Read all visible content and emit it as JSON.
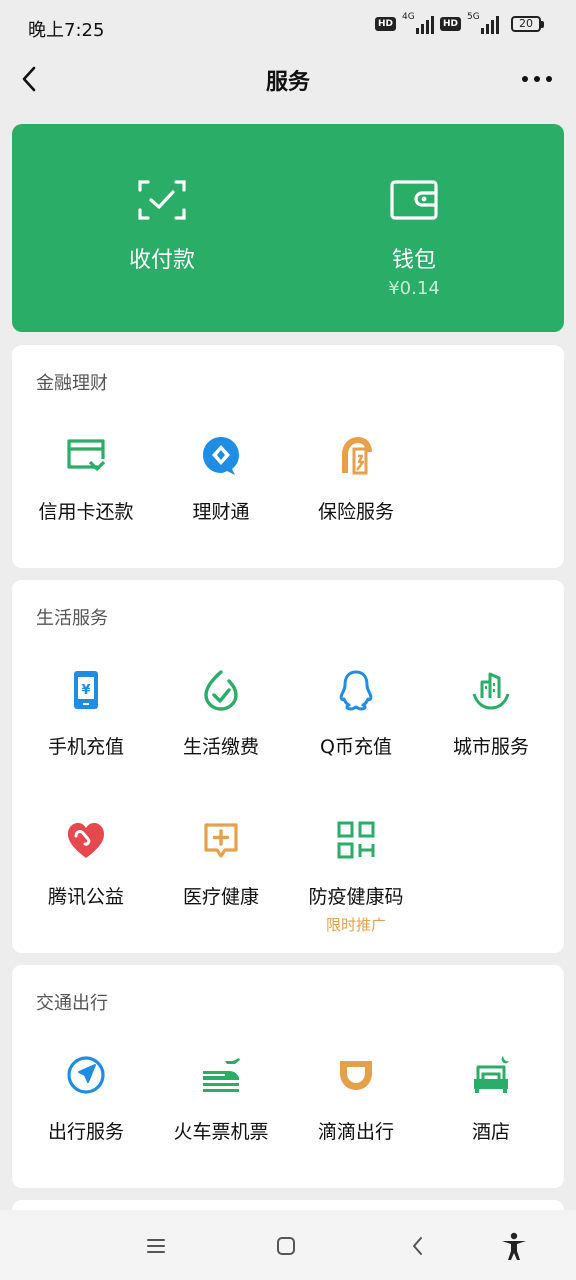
{
  "status_bar": {
    "time": "晚上7:25",
    "network_1": "4G",
    "network_2": "5G",
    "hd": "HD",
    "battery": "20"
  },
  "nav": {
    "title": "服务"
  },
  "wallet_card": {
    "color": "#2aae67",
    "pay": {
      "label": "收付款",
      "icon": "scan-check-icon"
    },
    "wallet": {
      "label": "钱包",
      "balance": "¥0.14",
      "icon": "wallet-icon"
    }
  },
  "sections": {
    "finance": {
      "title": "金融理财",
      "items": [
        {
          "label": "信用卡还款",
          "icon": "credit-card-icon"
        },
        {
          "label": "理财通",
          "icon": "licaitong-icon"
        },
        {
          "label": "保险服务",
          "icon": "insurance-icon"
        }
      ]
    },
    "life": {
      "title": "生活服务",
      "items": [
        {
          "label": "手机充值",
          "icon": "phone-topup-icon"
        },
        {
          "label": "生活缴费",
          "icon": "utility-bill-icon"
        },
        {
          "label": "Q币充值",
          "icon": "qq-coin-icon"
        },
        {
          "label": "城市服务",
          "icon": "city-service-icon"
        },
        {
          "label": "腾讯公益",
          "icon": "charity-heart-icon"
        },
        {
          "label": "医疗健康",
          "icon": "medical-icon"
        },
        {
          "label": "防疫健康码",
          "icon": "health-code-icon",
          "badge": "限时推广"
        }
      ]
    },
    "transport": {
      "title": "交通出行",
      "items": [
        {
          "label": "出行服务",
          "icon": "navigation-icon"
        },
        {
          "label": "火车票机票",
          "icon": "train-plane-icon"
        },
        {
          "label": "滴滴出行",
          "icon": "didi-icon"
        },
        {
          "label": "酒店",
          "icon": "hotel-icon"
        }
      ]
    }
  },
  "colors": {
    "green": "#2aae67",
    "blue": "#1e8de6",
    "orange": "#e7a04a",
    "red": "#e5484d",
    "background": "#ededed"
  }
}
